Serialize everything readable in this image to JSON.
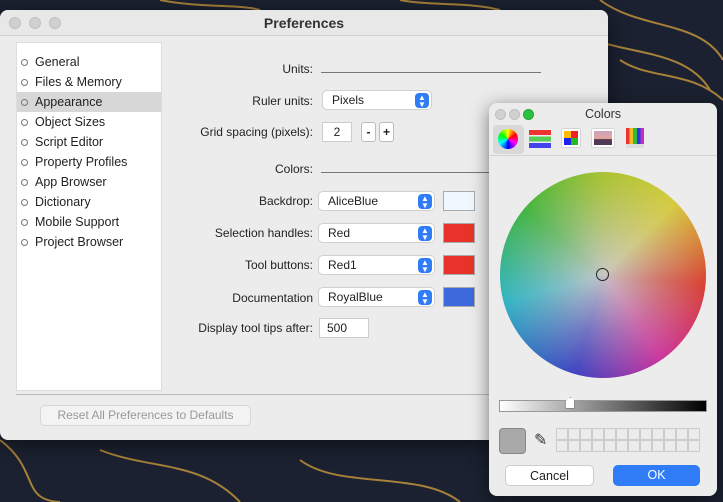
{
  "preferences": {
    "title": "Preferences",
    "sidebar": [
      {
        "label": "General"
      },
      {
        "label": "Files & Memory"
      },
      {
        "label": "Appearance",
        "selected": true
      },
      {
        "label": "Object Sizes"
      },
      {
        "label": "Script Editor"
      },
      {
        "label": "Property Profiles"
      },
      {
        "label": "App Browser"
      },
      {
        "label": "Dictionary"
      },
      {
        "label": "Mobile Support"
      },
      {
        "label": "Project Browser"
      }
    ],
    "units_label": "Units:",
    "ruler_units": {
      "label": "Ruler units:",
      "value": "Pixels"
    },
    "grid_spacing": {
      "label": "Grid spacing (pixels):",
      "value": "2",
      "minus": "-",
      "plus": "+"
    },
    "colors_label": "Colors:",
    "backdrop": {
      "label": "Backdrop:",
      "value": "AliceBlue",
      "color": "#F0F8FF"
    },
    "selection_handles": {
      "label": "Selection handles:",
      "value": "Red",
      "color": "#E8332A"
    },
    "tool_buttons": {
      "label": "Tool buttons:",
      "value": "Red1",
      "color": "#E8332A"
    },
    "documentation": {
      "label": "Documentation",
      "value": "RoyalBlue",
      "color": "#3C69DC"
    },
    "tooltips": {
      "label": "Display tool tips after:",
      "value": "500"
    },
    "reset_label": "Reset All Preferences to Defaults"
  },
  "colors_panel": {
    "title": "Colors",
    "tabs": [
      "color-wheel-icon",
      "sliders-icon",
      "palettes-icon",
      "image-palettes-icon",
      "pencils-icon"
    ],
    "current_color": "#A9A9A9",
    "brightness": 0.33,
    "cancel_label": "Cancel",
    "ok_label": "OK"
  }
}
